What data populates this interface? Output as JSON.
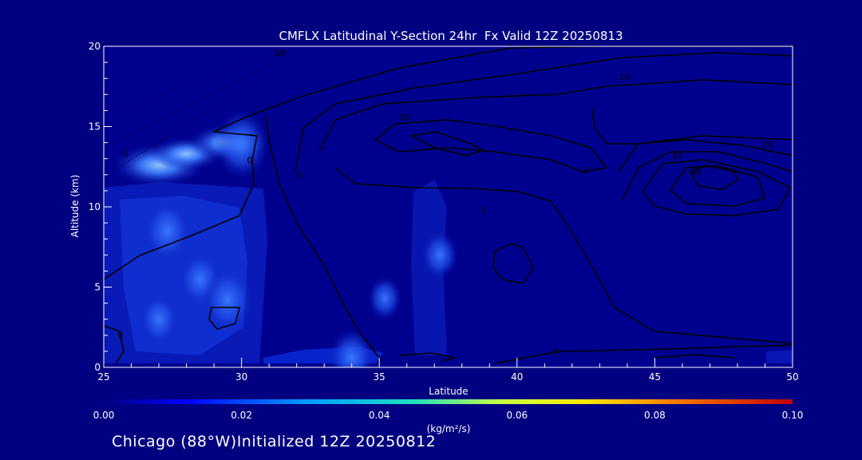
{
  "chart_data": {
    "type": "heatmap",
    "title": "CMFLX Latitudinal Y-Section 24hr  Fx Valid 12Z 20250813",
    "xlabel": "Latitude",
    "ylabel": "Altitude (km)",
    "xlim": [
      25,
      50
    ],
    "ylim": [
      0,
      20
    ],
    "x_ticks": [
      25,
      30,
      35,
      40,
      45,
      50
    ],
    "y_ticks": [
      0,
      5,
      10,
      15,
      20
    ],
    "colorbar": {
      "ticks": [
        "0.00",
        "0.02",
        "0.04",
        "0.06",
        "0.08",
        "0.10"
      ],
      "units": "(kg/m²/s)",
      "range": [
        0,
        0.1
      ]
    },
    "shaded_blobs": [
      {
        "lat": 27.0,
        "alt": 12.6,
        "value": 0.02
      },
      {
        "lat": 28.0,
        "alt": 13.3,
        "value": 0.014
      },
      {
        "lat": 29.5,
        "alt": 14.0,
        "value": 0.016
      },
      {
        "lat": 30.0,
        "alt": 13.9,
        "value": 0.012
      },
      {
        "lat": 27.3,
        "alt": 8.5,
        "value": 0.01
      },
      {
        "lat": 28.5,
        "alt": 5.5,
        "value": 0.008
      },
      {
        "lat": 29.5,
        "alt": 4.2,
        "value": 0.011
      },
      {
        "lat": 27.0,
        "alt": 3.0,
        "value": 0.007
      },
      {
        "lat": 37.2,
        "alt": 7.0,
        "value": 0.006
      },
      {
        "lat": 34.0,
        "alt": 0.6,
        "value": 0.009
      },
      {
        "lat": 35.2,
        "alt": 4.3,
        "value": 0.005
      }
    ],
    "contour_labels": [
      {
        "text": "20",
        "lat": 31.4,
        "alt": 19.6
      },
      {
        "text": "10",
        "lat": 43.9,
        "alt": 18.1
      },
      {
        "text": "20",
        "lat": 49.1,
        "alt": 13.9
      },
      {
        "text": "30",
        "lat": 35.9,
        "alt": 15.6
      },
      {
        "text": "30",
        "lat": 45.8,
        "alt": 13.2
      },
      {
        "text": "40",
        "lat": 46.5,
        "alt": 12.2
      },
      {
        "text": "5",
        "lat": 38.8,
        "alt": 9.8
      },
      {
        "text": "5",
        "lat": 42.5,
        "alt": 12.3
      },
      {
        "text": "0",
        "lat": 25.8,
        "alt": 13.3
      },
      {
        "text": "0",
        "lat": 30.3,
        "alt": 12.9
      },
      {
        "text": "0",
        "lat": 32.1,
        "alt": 12.0
      },
      {
        "text": "0",
        "lat": 41.4,
        "alt": 1.0
      },
      {
        "text": "0",
        "lat": 25.6,
        "alt": 2.0
      }
    ]
  },
  "footer": {
    "location": "Chicago (88°W)Initialized 12Z 20250812"
  }
}
